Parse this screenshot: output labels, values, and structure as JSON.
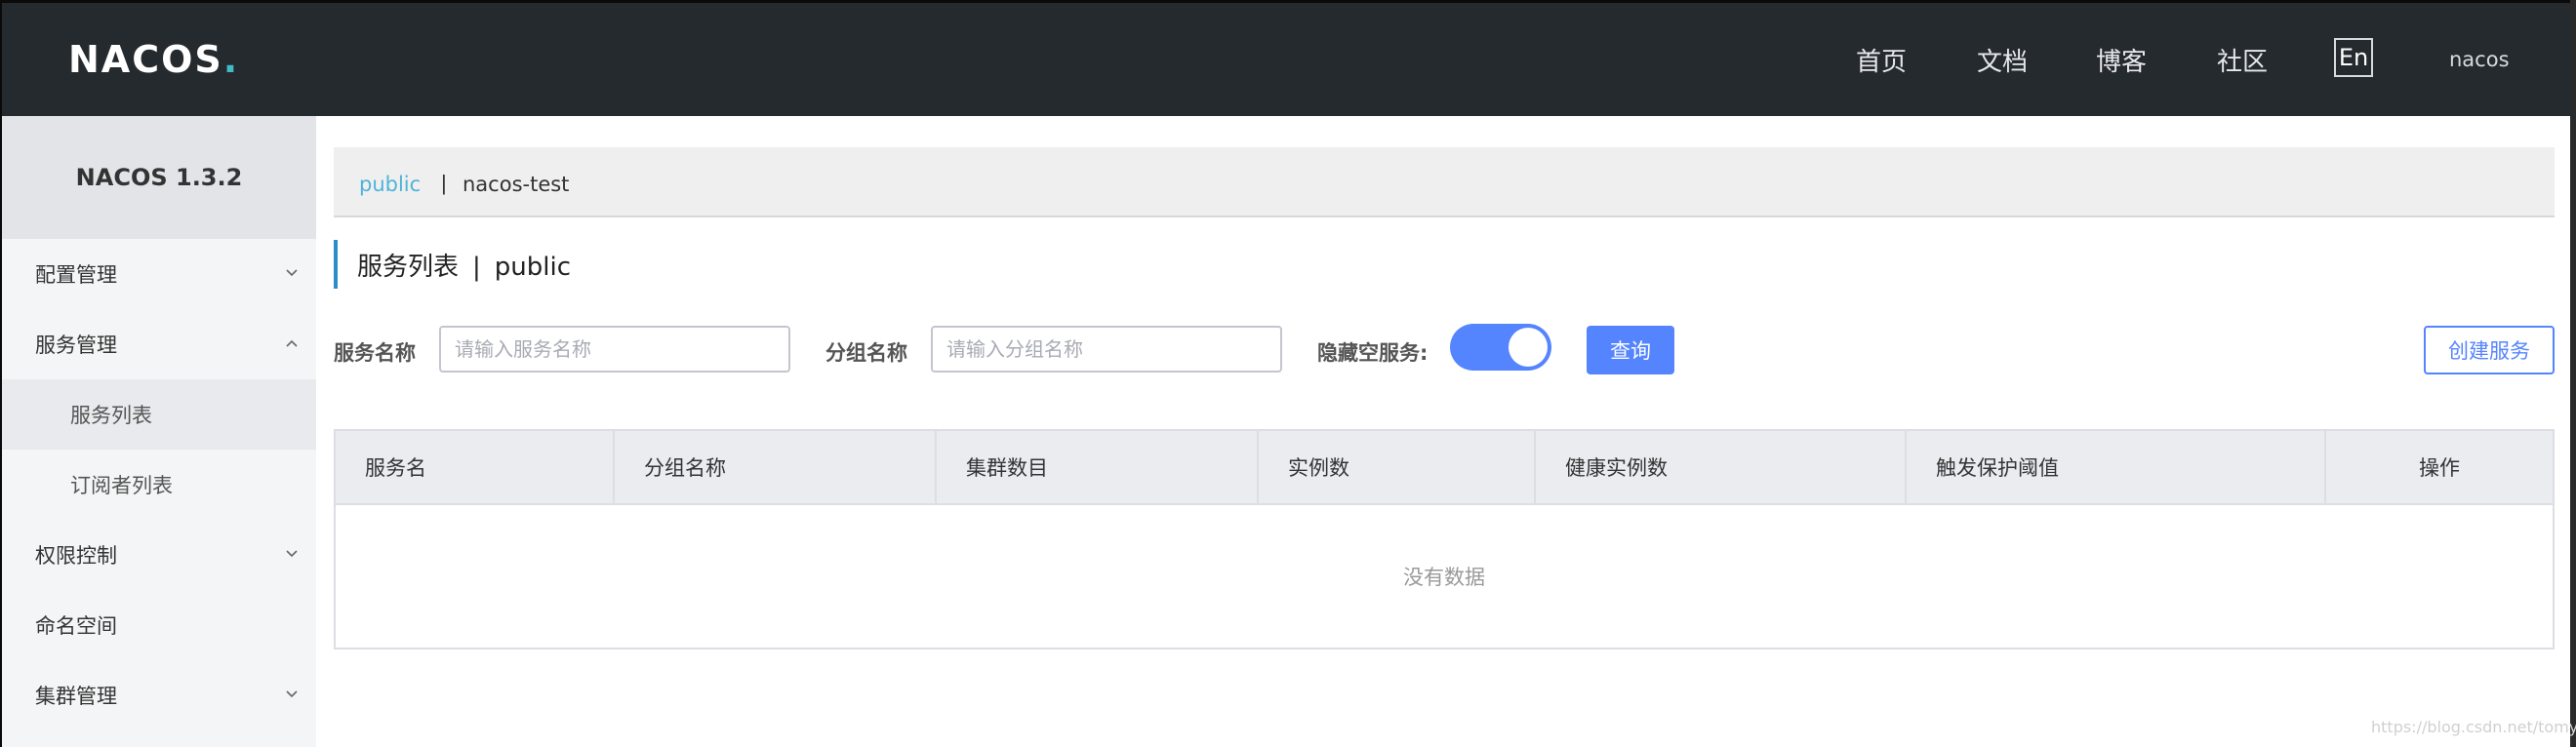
{
  "header": {
    "logo_main": "NACOS",
    "logo_dot": ".",
    "nav": [
      {
        "label": "首页"
      },
      {
        "label": "文档"
      },
      {
        "label": "博客"
      },
      {
        "label": "社区"
      }
    ],
    "lang": "En",
    "user": "nacos"
  },
  "sidebar": {
    "version": "NACOS 1.3.2",
    "items": [
      {
        "label": "配置管理",
        "chevron": "chevron-down-icon"
      },
      {
        "label": "服务管理",
        "chevron": "chevron-up-icon"
      },
      {
        "label": "服务列表"
      },
      {
        "label": "订阅者列表"
      },
      {
        "label": "权限控制",
        "chevron": "chevron-down-icon"
      },
      {
        "label": "命名空间"
      },
      {
        "label": "集群管理",
        "chevron": "chevron-down-icon"
      }
    ]
  },
  "namespace": {
    "active": "public",
    "separator": "|",
    "other": "nacos-test"
  },
  "page": {
    "title": "服务列表",
    "separator": "|",
    "namespace": "public"
  },
  "filters": {
    "service_label": "服务名称",
    "service_placeholder": "请输入服务名称",
    "group_label": "分组名称",
    "group_placeholder": "请输入分组名称",
    "hide_empty_label": "隐藏空服务:",
    "hide_empty_on": true,
    "query_button": "查询",
    "create_button": "创建服务"
  },
  "table": {
    "columns": [
      "服务名",
      "分组名称",
      "集群数目",
      "实例数",
      "健康实例数",
      "触发保护阈值",
      "操作"
    ],
    "empty_text": "没有数据"
  },
  "watermark": "https://blog.csdn.net/tomyLin",
  "colors": {
    "header_bg": "#252a2f",
    "accent": "#5584ff",
    "link": "#4fb4d8",
    "logo_accent": "#3fbcc5"
  }
}
